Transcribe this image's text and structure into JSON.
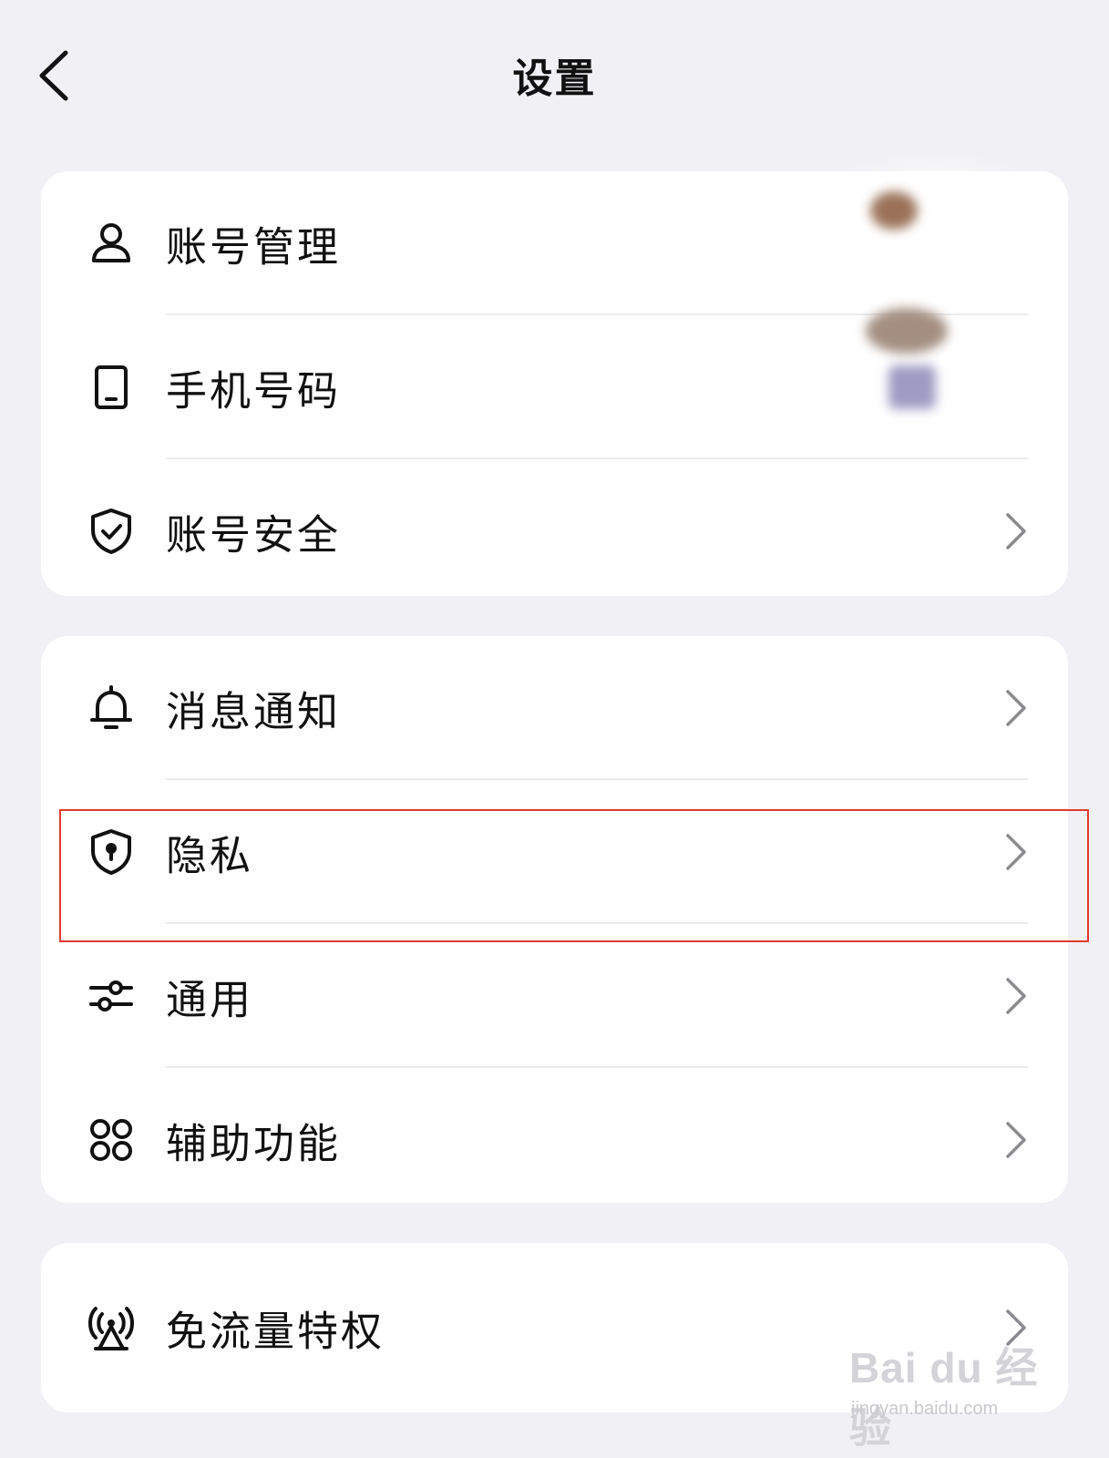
{
  "header": {
    "title": "设置",
    "back_icon": "chevron-left-icon"
  },
  "groups": [
    {
      "items": [
        {
          "label": "账号管理",
          "icon": "person-icon",
          "chevron": false
        },
        {
          "label": "手机号码",
          "icon": "phone-icon",
          "chevron": false
        },
        {
          "label": "账号安全",
          "icon": "shield-check-icon",
          "chevron": true
        }
      ]
    },
    {
      "items": [
        {
          "label": "消息通知",
          "icon": "bell-icon",
          "chevron": true
        },
        {
          "label": "隐私",
          "icon": "shield-lock-icon",
          "chevron": true,
          "highlighted": true
        },
        {
          "label": "通用",
          "icon": "sliders-icon",
          "chevron": true
        },
        {
          "label": "辅助功能",
          "icon": "grid-icon",
          "chevron": true
        }
      ]
    },
    {
      "items": [
        {
          "label": "免流量特权",
          "icon": "signal-tower-icon",
          "chevron": true
        }
      ]
    }
  ],
  "watermark": {
    "main": "Bai du 经验",
    "sub": "jingyan.baidu.com"
  },
  "colors": {
    "background": "#f1f1f5",
    "card": "#ffffff",
    "highlight": "#e03a2f"
  }
}
